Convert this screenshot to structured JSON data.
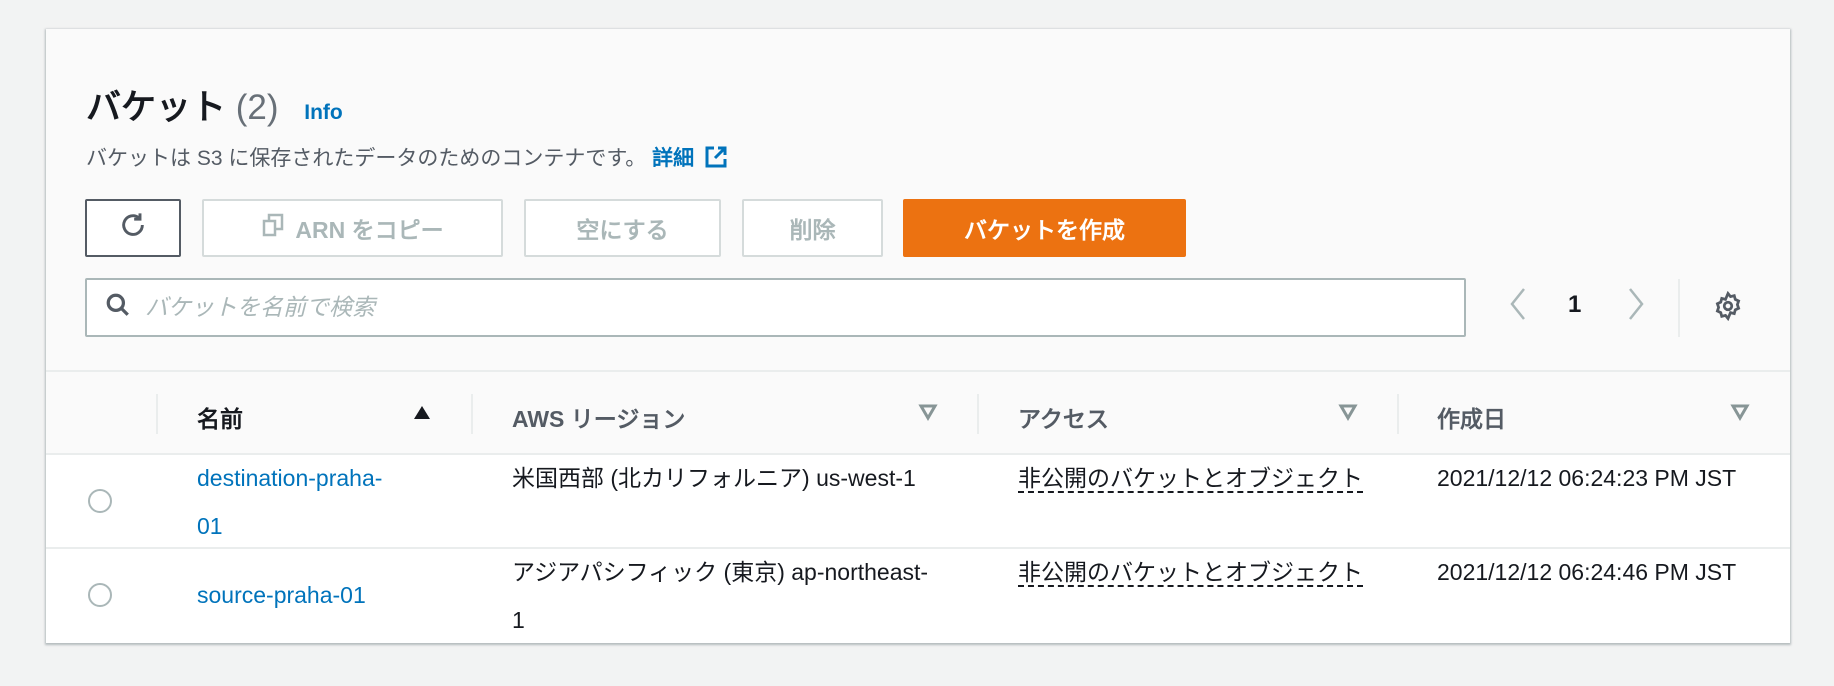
{
  "header": {
    "title": "バケット",
    "count": "(2)",
    "info": "Info",
    "description": "バケットは S3 に保存されたデータのためのコンテナです。",
    "learn_more": "詳細"
  },
  "toolbar": {
    "copy_arn": "ARN をコピー",
    "empty": "空にする",
    "delete": "削除",
    "create": "バケットを作成"
  },
  "search": {
    "placeholder": "バケットを名前で検索",
    "value": ""
  },
  "pagination": {
    "current_page": "1"
  },
  "table": {
    "columns": [
      "名前",
      "AWS リージョン",
      "アクセス",
      "作成日"
    ],
    "rows": [
      {
        "name": "destination-praha-01",
        "region": "米国西部 (北カリフォルニア) us-west-1",
        "access": "非公開のバケットとオブジェクト",
        "created": "2021/12/12 06:24:23 PM JST"
      },
      {
        "name": "source-praha-01",
        "region": "アジアパシフィック (東京) ap-northeast-1",
        "access": "非公開のバケットとオブジェクト",
        "created": "2021/12/12 06:24:46 PM JST"
      }
    ]
  },
  "colors": {
    "accent": "#ec7211",
    "link": "#0073bb"
  }
}
